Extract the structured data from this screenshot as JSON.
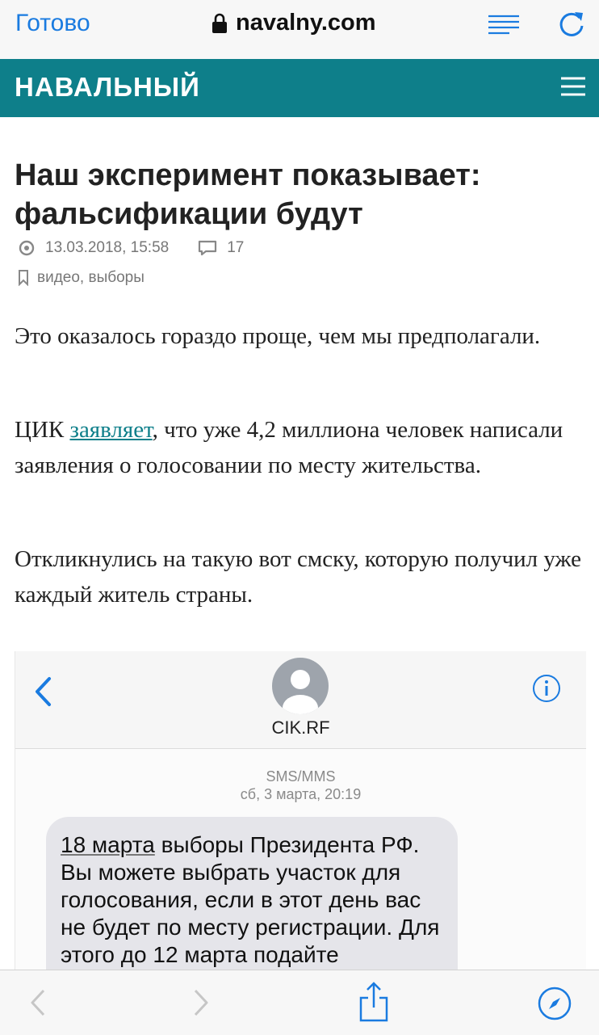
{
  "browser": {
    "done_label": "Готово",
    "url": "navalny.com"
  },
  "site": {
    "brand": "НАВАЛЬНЫЙ"
  },
  "article": {
    "title": "Наш эксперимент показывает: фальсификации будут",
    "date": "13.03.2018, 15:58",
    "comments": "17",
    "tags": "видео, выборы",
    "p1": "Это оказалось гораздо проще, чем мы предполагали.",
    "p2_before": "ЦИК ",
    "p2_link": "заявляет",
    "p2_after": ", что уже 4,2 миллиона человек написали заявления о голосовании по месту жительства.",
    "p3": "Откликнулись на такую вот смску, которую получил уже каждый житель страны."
  },
  "sms": {
    "contact": "CIK.RF",
    "type": "SMS/MMS",
    "date": "сб, 3 марта, 20:19",
    "msg_underlined": "18 марта",
    "msg_rest": " выборы Президента РФ. Вы можете выбрать участок для голосования, если в этот день вас не будет по месту регистрации. Для этого до 12 марта подайте"
  },
  "colors": {
    "brand_bg": "#0e7f8a",
    "ios_blue": "#1a7be0"
  }
}
